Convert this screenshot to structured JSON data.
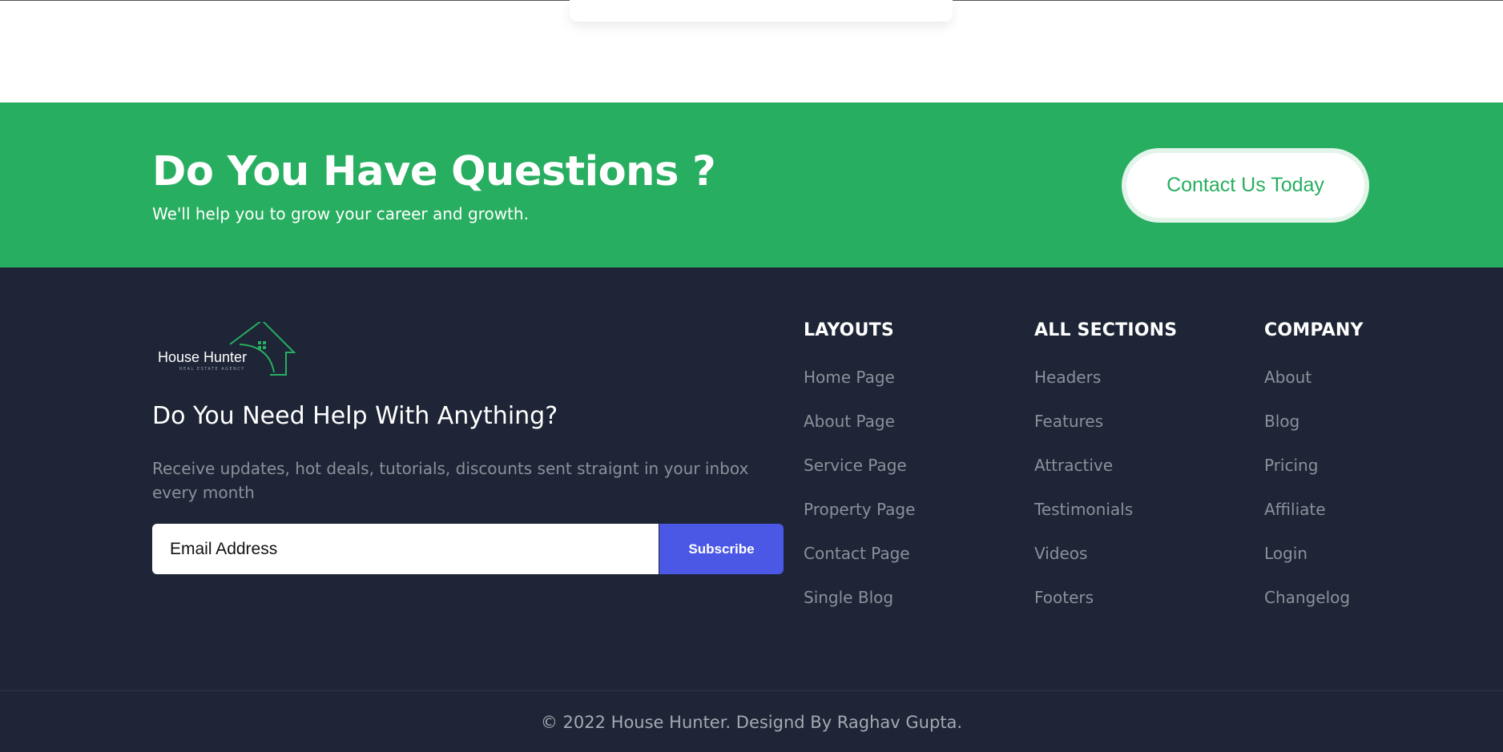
{
  "colors": {
    "cta_background": "#28ae60",
    "footer_background": "#1e2536",
    "subscribe_button": "#4b57e5",
    "link_text": "#8b909a"
  },
  "cta": {
    "title": "Do You Have Questions ?",
    "subtitle": "We'll help you to grow your career and growth.",
    "button_label": "Contact Us Today"
  },
  "footer": {
    "logo": {
      "name": "House Hunter",
      "tagline": "REAL ESTATE AGENCY",
      "icon": "house-icon"
    },
    "help_title": "Do You Need Help With Anything?",
    "help_desc": "Receive updates, hot deals, tutorials, discounts sent straignt in your inbox every month",
    "newsletter": {
      "email_placeholder": "Email Address",
      "subscribe_label": "Subscribe"
    },
    "columns": [
      {
        "title": "LAYOUTS",
        "links": [
          "Home Page",
          "About Page",
          "Service Page",
          "Property Page",
          "Contact Page",
          "Single Blog"
        ]
      },
      {
        "title": "ALL SECTIONS",
        "links": [
          "Headers",
          "Features",
          "Attractive",
          "Testimonials",
          "Videos",
          "Footers"
        ]
      },
      {
        "title": "COMPANY",
        "links": [
          "About",
          "Blog",
          "Pricing",
          "Affiliate",
          "Login",
          "Changelog"
        ]
      }
    ],
    "copyright": "© 2022 House Hunter. Designd By Raghav Gupta."
  }
}
